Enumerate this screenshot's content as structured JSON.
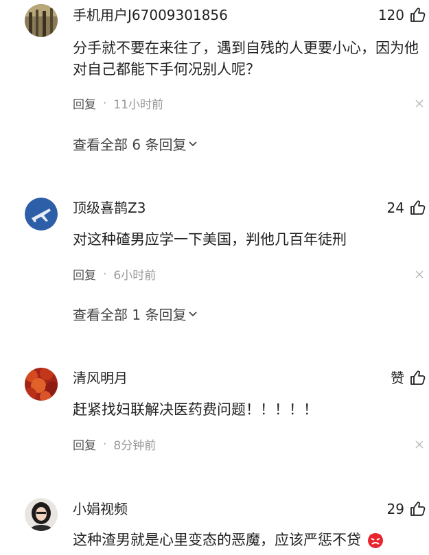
{
  "comments": [
    {
      "username": "手机用户J67009301856",
      "likes": "120",
      "text": "分手就不要在来往了，遇到自残的人更要小心，因为他对自己都能下手何况别人呢？",
      "reply_label": "回复",
      "separator": "·",
      "time": "11小时前",
      "view_all": "查看全部 6 条回复"
    },
    {
      "username": "顶级喜鹊Z3",
      "likes": "24",
      "text": "对这种碴男应学一下美国，判他几百年徒刑",
      "reply_label": "回复",
      "separator": "·",
      "time": "6小时前",
      "view_all": "查看全部 1 条回复"
    },
    {
      "username": "清风明月",
      "likes": "赞",
      "text": "赶紧找妇联解决医药费问题！！！！！",
      "reply_label": "回复",
      "separator": "·",
      "time": "8分钟前"
    },
    {
      "username": "小娟视频",
      "likes": "29",
      "text": "这种渣男就是心里变态的恶魔，应该严惩不贷"
    }
  ],
  "icons": {
    "like": "thumbs-up-icon",
    "close": "close-icon",
    "expand": "chevron-down-icon",
    "emoji": "angry-face-emoji"
  },
  "colors": {
    "text": "#222222",
    "meta": "#999999",
    "emoji": "#e8262f"
  }
}
